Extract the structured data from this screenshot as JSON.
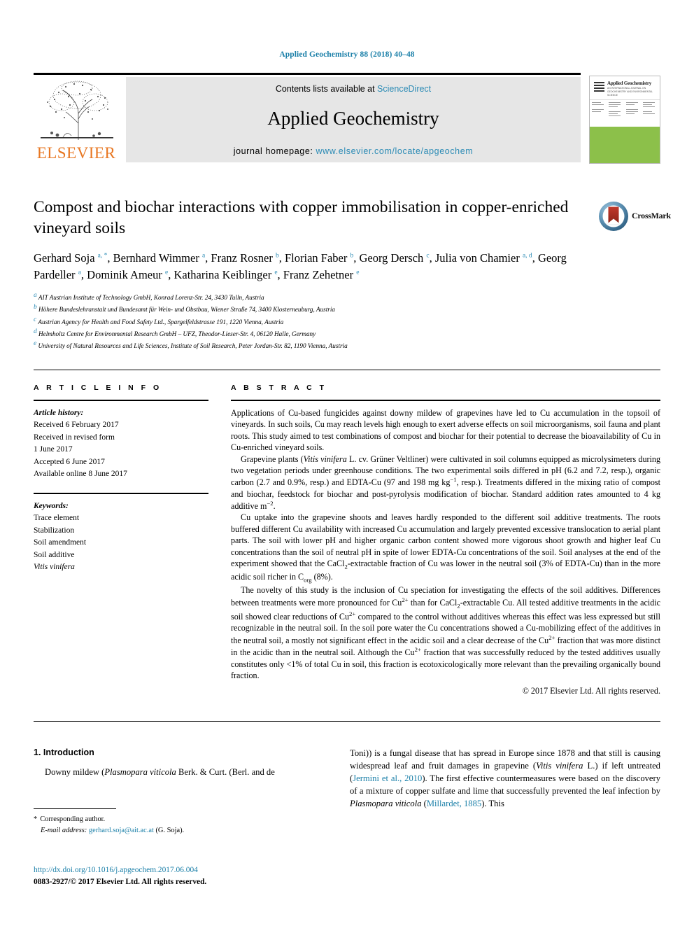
{
  "running_head": "Applied Geochemistry 88 (2018) 40–48",
  "masthead": {
    "contents_prefix": "Contents lists available at ",
    "contents_link": "ScienceDirect",
    "journal_name": "Applied Geochemistry",
    "homepage_prefix": "journal homepage: ",
    "homepage_link": "www.elsevier.com/locate/apgeochem",
    "publisher": "ELSEVIER",
    "cover_title": "Applied Geochemistry",
    "cover_subtitle": "AN INTERNATIONAL JOURNAL ON GEOCHEMISTRY AND ENVIRONMENTAL SCIENCE",
    "accent_link_color": "#2b8bb5",
    "cover_green": "#8cc04a",
    "elsevier_orange": "#e87722"
  },
  "crossmark": {
    "label": "CrossMark"
  },
  "article": {
    "title": "Compost and biochar interactions with copper immobilisation in copper-enriched vineyard soils",
    "authors_html": "Gerhard Soja <sup>a, *</sup>, Bernhard Wimmer <sup>a</sup>, Franz Rosner <sup>b</sup>, Florian Faber <sup>b</sup>, Georg Dersch <sup>c</sup>, Julia von Chamier <sup>a, d</sup>, Georg Pardeller <sup>a</sup>, Dominik Ameur <sup>e</sup>, Katharina Keiblinger <sup>e</sup>, Franz Zehetner <sup>e</sup>",
    "affiliations": [
      "AIT Austrian Institute of Technology GmbH, Konrad Lorenz-Str. 24, 3430 Tulln, Austria",
      "Höhere Bundeslehranstalt und Bundesamt für Wein- und Obstbau, Wiener Straße 74, 3400 Klosterneuburg, Austria",
      "Austrian Agency for Health and Food Safety Ltd., Spargelfeldstrasse 191, 1220 Vienna, Austria",
      "Helmholtz Centre for Environmental Research GmbH – UFZ, Theodor-Lieser-Str. 4, 06120 Halle, Germany",
      "University of Natural Resources and Life Sciences, Institute of Soil Research, Peter Jordan-Str. 82, 1190 Vienna, Austria"
    ],
    "affiliation_marks": [
      "a",
      "b",
      "c",
      "d",
      "e"
    ]
  },
  "article_info": {
    "heading": "A R T I C L E   I N F O",
    "history_label": "Article history:",
    "history": [
      "Received 6 February 2017",
      "Received in revised form",
      "1 June 2017",
      "Accepted 6 June 2017",
      "Available online 8 June 2017"
    ],
    "keywords_label": "Keywords:",
    "keywords": [
      "Trace element",
      "Stabilization",
      "Soil amendment",
      "Soil additive",
      "Vitis vinifera"
    ],
    "keyword_italic_index": 4
  },
  "abstract": {
    "heading": "A B S T R A C T",
    "paragraphs_html": [
      "Applications of Cu-based fungicides against downy mildew of grapevines have led to Cu accumulation in the topsoil of vineyards. In such soils, Cu may reach levels high enough to exert adverse effects on soil microorganisms, soil fauna and plant roots. This study aimed to test combinations of compost and biochar for their potential to decrease the bioavailability of Cu in Cu-enriched vineyard soils.",
      "Grapevine plants (<i>Vitis vinifera</i> L. cv. Grüner Veltliner) were cultivated in soil columns equipped as microlysimeters during two vegetation periods under greenhouse conditions. The two experimental soils differed in pH (6.2 and 7.2, resp.), organic carbon (2.7 and 0.9%, resp.) and EDTA-Cu (97 and 198 mg kg<sup class=\"num\">−1</sup>, resp.). Treatments differed in the mixing ratio of compost and biochar, feedstock for biochar and post-pyrolysis modification of biochar. Standard addition rates amounted to 4 kg additive m<sup class=\"num\">−2</sup>.",
      "Cu uptake into the grapevine shoots and leaves hardly responded to the different soil additive treatments. The roots buffered different Cu availability with increased Cu accumulation and largely prevented excessive translocation to aerial plant parts. The soil with lower pH and higher organic carbon content showed more vigorous shoot growth and higher leaf Cu concentrations than the soil of neutral pH in spite of lower EDTA-Cu concentrations of the soil. Soil analyses at the end of the experiment showed that the CaCl<sub>2</sub>-extractable fraction of Cu was lower in the neutral soil (3% of EDTA-Cu) than in the more acidic soil richer in C<sub>org</sub> (8%).",
      "The novelty of this study is the inclusion of Cu speciation for investigating the effects of the soil additives. Differences between treatments were more pronounced for Cu<sup class=\"num\">2+</sup> than for CaCl<sub>2</sub>-extractable Cu. All tested additive treatments in the acidic soil showed clear reductions of Cu<sup class=\"num\">2+</sup> compared to the control without additives whereas this effect was less expressed but still recognizable in the neutral soil. In the soil pore water the Cu concentrations showed a Cu-mobilizing effect of the additives in the neutral soil, a mostly not significant effect in the acidic soil and a clear decrease of the Cu<sup class=\"num\">2+</sup> fraction that was more distinct in the acidic than in the neutral soil. Although the Cu<sup class=\"num\">2+</sup> fraction that was successfully reduced by the tested additives usually constitutes only &lt;1% of total Cu in soil, this fraction is ecotoxicologically more relevant than the prevailing organically bound fraction."
    ],
    "copyright": "© 2017 Elsevier Ltd. All rights reserved."
  },
  "body": {
    "section_number_title": "1. Introduction",
    "left_paragraph_html": "Downy mildew (<i>Plasmopara viticola</i> Berk. &amp; Curt. (Berl. and de",
    "right_paragraph_html": "Toni)) is a fungal disease that has spread in Europe since 1878 and that still is causing widespread leaf and fruit damages in grapevine (<i>Vitis vinifera</i> L.) if left untreated (<span class=\"cite\">Jermini et al., 2010</span>). The first effective countermeasures were based on the discovery of a mixture of copper sulfate and lime that successfully prevented the leaf infection by <i>Plasmopara viticola</i> (<span class=\"cite\">Millardet, 1885</span>). This"
  },
  "footnote": {
    "corresponding": "Corresponding author.",
    "email_label": "E-mail address:",
    "email": "gerhard.soja@ait.ac.at",
    "email_suffix": "(G. Soja)."
  },
  "imprint": {
    "doi": "http://dx.doi.org/10.1016/j.apgeochem.2017.06.004",
    "issn_line": "0883-2927/© 2017 Elsevier Ltd. All rights reserved."
  }
}
